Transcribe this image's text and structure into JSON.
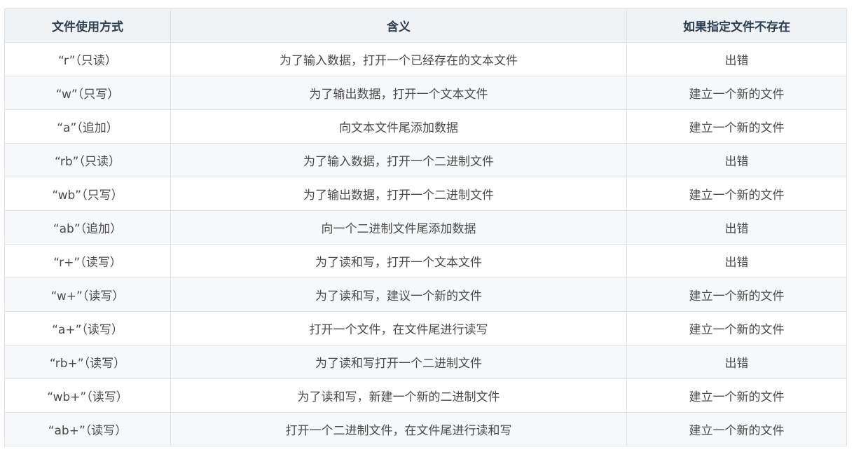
{
  "table": {
    "headers": [
      "文件使用方式",
      "含义",
      "如果指定文件不存在"
    ],
    "rows": [
      [
        "“r”（只读）",
        "为了输入数据，打开一个已经存在的文本文件",
        "出错"
      ],
      [
        "“w”（只写）",
        "为了输出数据，打开一个文本文件",
        "建立一个新的文件"
      ],
      [
        "“a”（追加）",
        "向文本文件尾添加数据",
        "建立一个新的文件"
      ],
      [
        "“rb”（只读）",
        "为了输入数据，打开一个二进制文件",
        "出错"
      ],
      [
        "“wb”（只写）",
        "为了输出数据，打开一个二进制文件",
        "建立一个新的文件"
      ],
      [
        "“ab”（追加）",
        "向一个二进制文件尾添加数据",
        "出错"
      ],
      [
        "“r+”（读写）",
        "为了读和写，打开一个文本文件",
        "出错"
      ],
      [
        "“w+”（读写）",
        "为了读和写，建议一个新的文件",
        "建立一个新的文件"
      ],
      [
        "“a+”（读写）",
        "打开一个文件，在文件尾进行读写",
        "建立一个新的文件"
      ],
      [
        "“rb+”（读写）",
        "为了读和写打开一个二进制文件",
        "出错"
      ],
      [
        "“wb+”（读写）",
        "为了读和写，新建一个新的二进制文件",
        "建立一个新的文件"
      ],
      [
        "“ab+”（读写）",
        "打开一个二进制文件，在文件尾进行读和写",
        "建立一个新的文件"
      ]
    ]
  }
}
